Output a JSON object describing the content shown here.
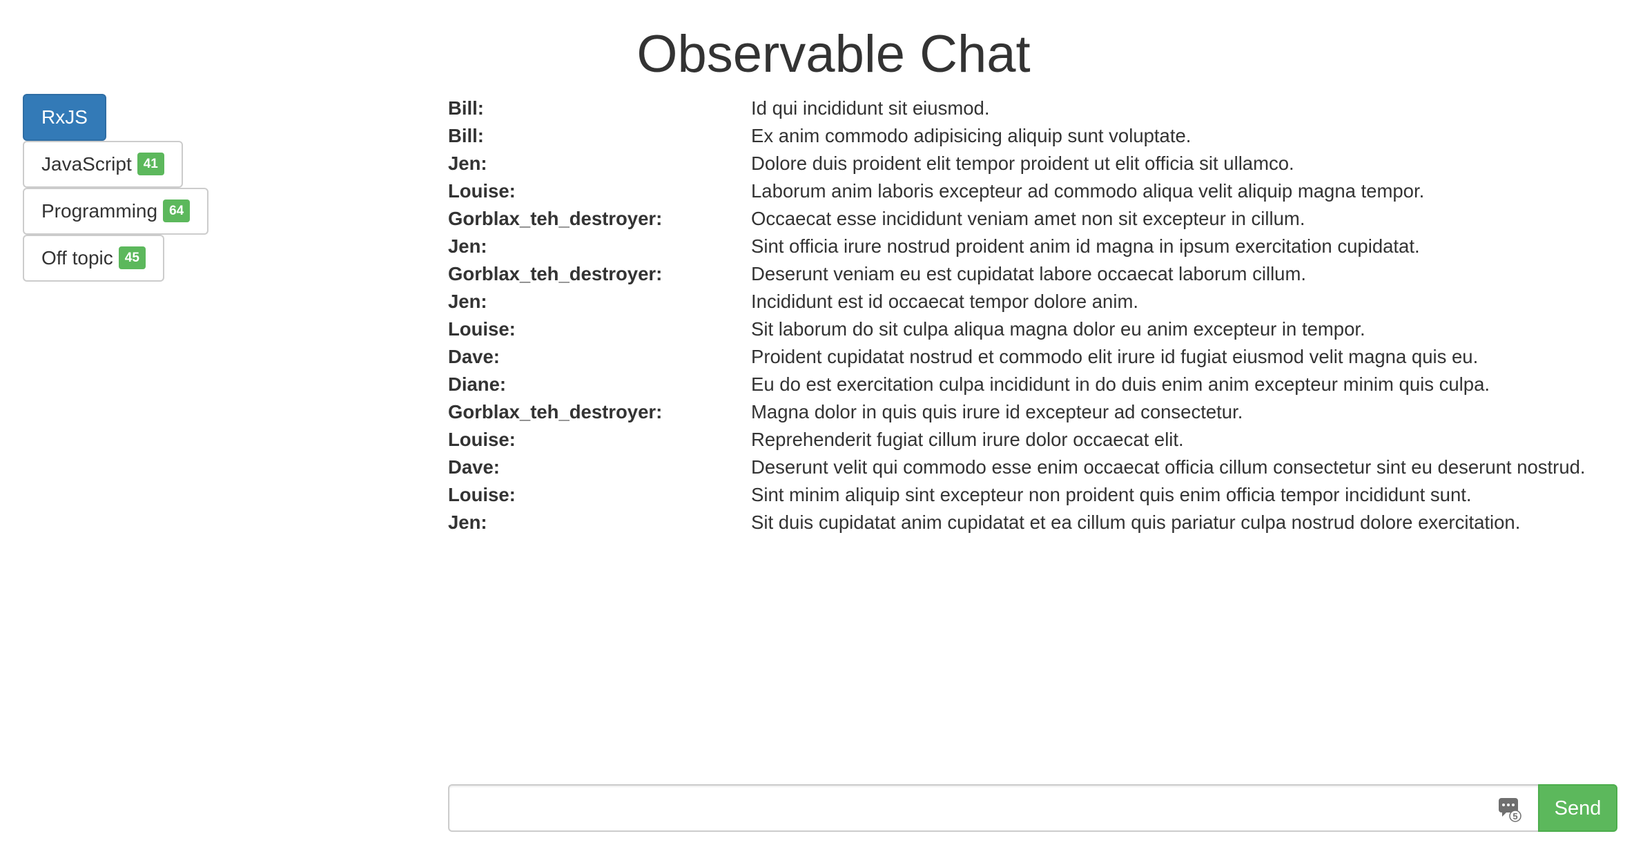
{
  "title": "Observable Chat",
  "rooms": [
    {
      "label": "RxJS",
      "badge": "",
      "active": true
    },
    {
      "label": "JavaScript",
      "badge": "41",
      "active": false
    },
    {
      "label": "Programming",
      "badge": "64",
      "active": false
    },
    {
      "label": "Off topic",
      "badge": "45",
      "active": false
    }
  ],
  "messages": [
    {
      "author": "Bill:",
      "text": "Id qui incididunt sit eiusmod."
    },
    {
      "author": "Bill:",
      "text": "Ex anim commodo adipisicing aliquip sunt voluptate."
    },
    {
      "author": "Jen:",
      "text": "Dolore duis proident elit tempor proident ut elit officia sit ullamco."
    },
    {
      "author": "Louise:",
      "text": "Laborum anim laboris excepteur ad commodo aliqua velit aliquip magna tempor."
    },
    {
      "author": "Gorblax_teh_destroyer:",
      "text": "Occaecat esse incididunt veniam amet non sit excepteur in cillum."
    },
    {
      "author": "Jen:",
      "text": "Sint officia irure nostrud proident anim id magna in ipsum exercitation cupidatat."
    },
    {
      "author": "Gorblax_teh_destroyer:",
      "text": "Deserunt veniam eu est cupidatat labore occaecat laborum cillum."
    },
    {
      "author": "Jen:",
      "text": "Incididunt est id occaecat tempor dolore anim."
    },
    {
      "author": "Louise:",
      "text": "Sit laborum do sit culpa aliqua magna dolor eu anim excepteur in tempor."
    },
    {
      "author": "Dave:",
      "text": "Proident cupidatat nostrud et commodo elit irure id fugiat eiusmod velit magna quis eu."
    },
    {
      "author": "Diane:",
      "text": "Eu do est exercitation culpa incididunt in do duis enim anim excepteur minim quis culpa."
    },
    {
      "author": "Gorblax_teh_destroyer:",
      "text": "Magna dolor in quis quis irure id excepteur ad consectetur."
    },
    {
      "author": "Louise:",
      "text": "Reprehenderit fugiat cillum irure dolor occaecat elit."
    },
    {
      "author": "Dave:",
      "text": "Deserunt velit qui commodo esse enim occaecat officia cillum consectetur sint eu deserunt nostrud."
    },
    {
      "author": "Louise:",
      "text": "Sint minim aliquip sint excepteur non proident quis enim officia tempor incididunt sunt."
    },
    {
      "author": "Jen:",
      "text": "Sit duis cupidatat anim cupidatat et ea cillum quis pariatur culpa nostrud dolore exercitation."
    }
  ],
  "composer": {
    "value": "",
    "placeholder": "",
    "icon": "keyboard-shortcut-icon",
    "icon_count": "5",
    "send_label": "Send"
  },
  "colors": {
    "active_room": "#337ab7",
    "badge": "#5cb85c",
    "send_button": "#5cb85c",
    "text": "#333333"
  }
}
